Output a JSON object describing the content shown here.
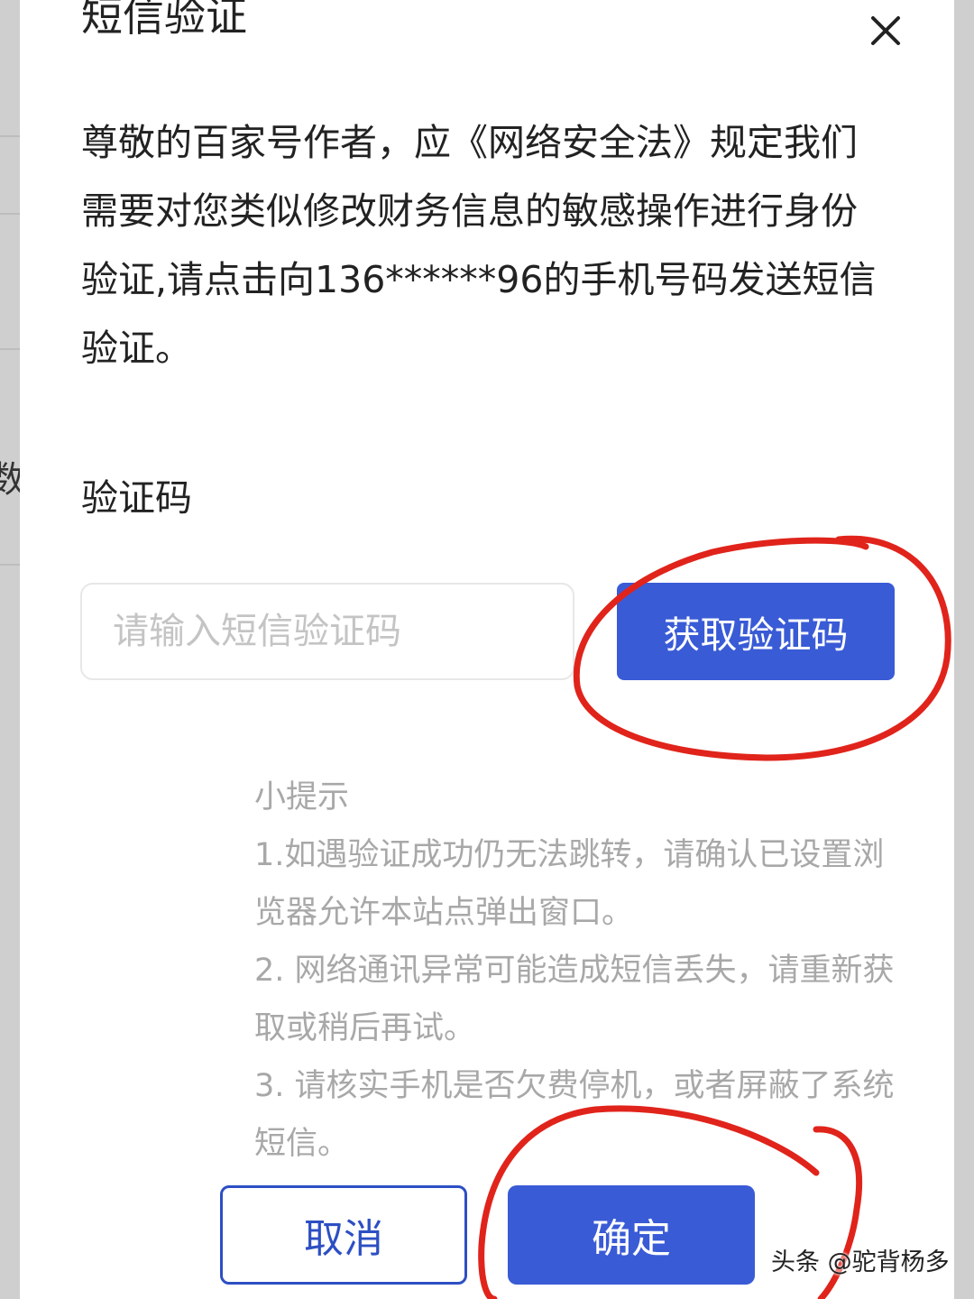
{
  "dialog": {
    "title": "短信验证",
    "close_icon": "close-icon",
    "intro_text": "尊敬的百家号作者，应《网络安全法》规定我们需要对您类似修改财务信息的敏感操作进行身份验证,请点击向136******96的手机号码发送短信验证。",
    "code_label": "验证码",
    "code_input": {
      "value": "",
      "placeholder": "请输入短信验证码"
    },
    "get_code_button": "获取验证码",
    "tips": {
      "heading": "小提示",
      "items": [
        "1.如遇验证成功仍无法跳转，请确认已设置浏览器允许本站点弹出窗口。",
        "2. 网络通讯异常可能造成短信丢失，请重新获取或稍后再试。",
        "3. 请核实手机是否欠费停机，或者屏蔽了系统短信。"
      ]
    },
    "cancel_button": "取消",
    "confirm_button": "确定"
  },
  "background": {
    "partial_char": "数"
  },
  "watermark": "头条 @驼背杨多",
  "colors": {
    "primary": "#3a5bd6",
    "annotation": "#e0241b",
    "tip_text": "#a8a8a8"
  }
}
